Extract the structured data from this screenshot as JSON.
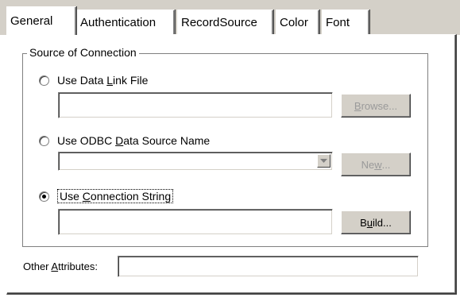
{
  "tabs": [
    {
      "label": "General",
      "active": true
    },
    {
      "label": "Authentication",
      "active": false
    },
    {
      "label": "RecordSource",
      "active": false
    },
    {
      "label": "Color",
      "active": false
    },
    {
      "label": "Font",
      "active": false
    }
  ],
  "group": {
    "title": "Source of Connection"
  },
  "data_link": {
    "radio_label_pre": "Use Data ",
    "radio_label_u": "L",
    "radio_label_post": "ink File",
    "selected": false,
    "value": "",
    "browse_pre": "",
    "browse_u": "B",
    "browse_post": "rowse..."
  },
  "odbc": {
    "radio_label_pre": "Use ODBC ",
    "radio_label_u": "D",
    "radio_label_post": "ata Source Name",
    "selected": false,
    "value": "",
    "new_pre": "Ne",
    "new_u": "w",
    "new_post": "..."
  },
  "conn_string": {
    "radio_label_pre": "Use ",
    "radio_label_u": "C",
    "radio_label_post": "onnection String",
    "selected": true,
    "value": "",
    "build_pre": "B",
    "build_u": "u",
    "build_post": "ild..."
  },
  "other": {
    "label_pre": "Other ",
    "label_u": "A",
    "label_post": "ttributes:",
    "value": ""
  }
}
